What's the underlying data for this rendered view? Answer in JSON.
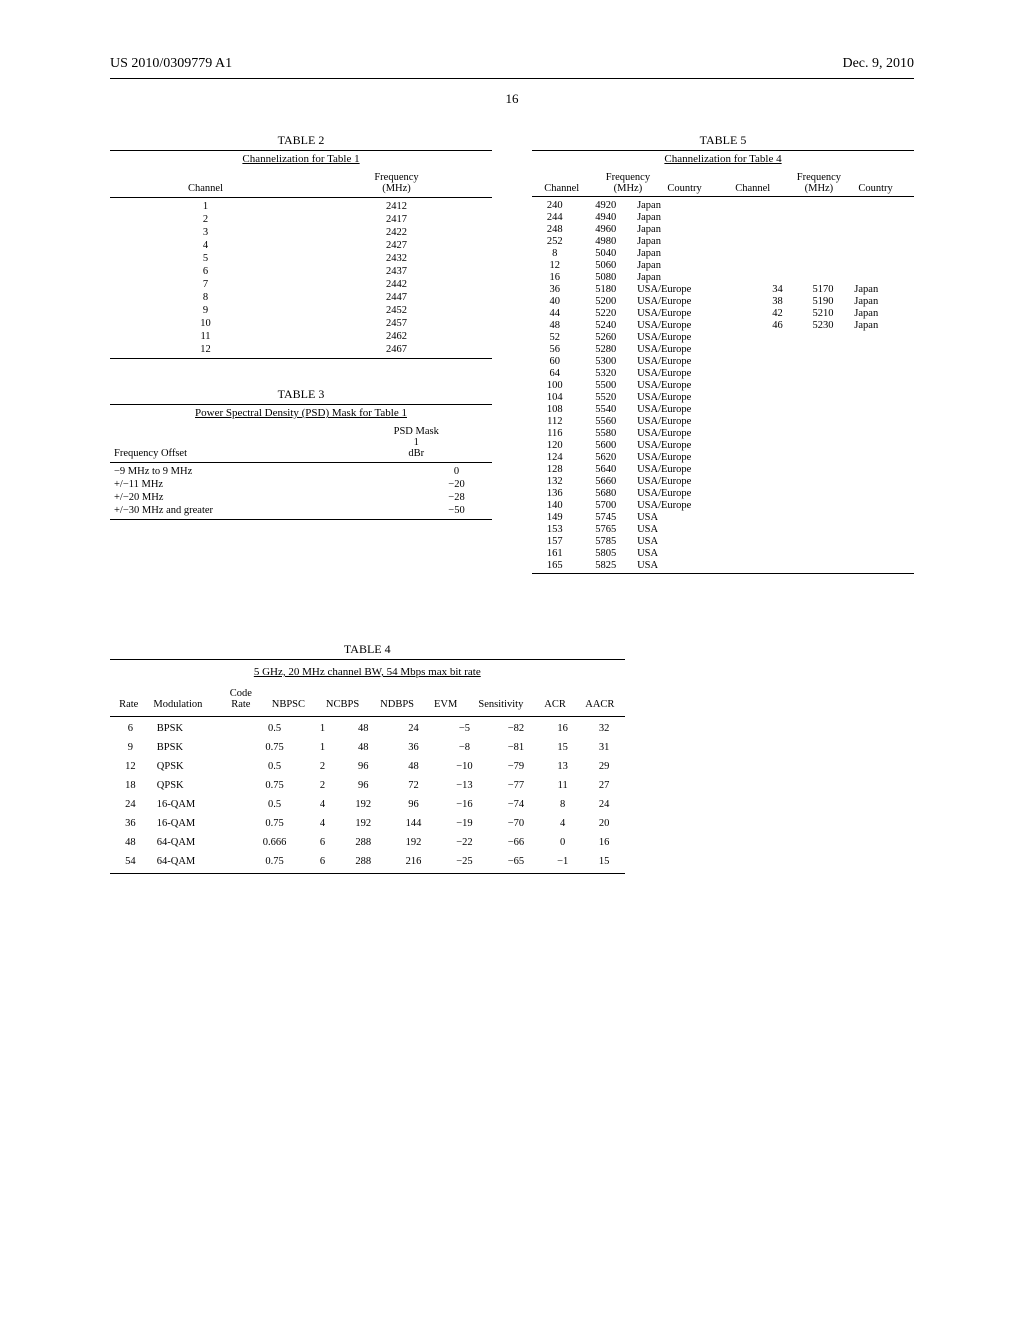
{
  "header": {
    "left": "US 2010/0309779 A1",
    "right": "Dec. 9, 2010"
  },
  "page_number": "16",
  "table2": {
    "title": "TABLE 2",
    "subtitle": "Channelization for Table 1",
    "head": {
      "c1": "Channel",
      "c2a": "Frequency",
      "c2b": "(MHz)"
    },
    "rows": [
      {
        "ch": "1",
        "f": "2412"
      },
      {
        "ch": "2",
        "f": "2417"
      },
      {
        "ch": "3",
        "f": "2422"
      },
      {
        "ch": "4",
        "f": "2427"
      },
      {
        "ch": "5",
        "f": "2432"
      },
      {
        "ch": "6",
        "f": "2437"
      },
      {
        "ch": "7",
        "f": "2442"
      },
      {
        "ch": "8",
        "f": "2447"
      },
      {
        "ch": "9",
        "f": "2452"
      },
      {
        "ch": "10",
        "f": "2457"
      },
      {
        "ch": "11",
        "f": "2462"
      },
      {
        "ch": "12",
        "f": "2467"
      }
    ]
  },
  "table3": {
    "title": "TABLE 3",
    "subtitle": "Power Spectral Density (PSD) Mask for Table 1",
    "head": {
      "c1": "Frequency Offset",
      "c2a": "PSD Mask",
      "c2b": "1",
      "c2c": "dBr"
    },
    "rows": [
      {
        "o": "−9 MHz to 9 MHz",
        "v": "0"
      },
      {
        "o": "+/−11 MHz",
        "v": "−20"
      },
      {
        "o": "+/−20 MHz",
        "v": "−28"
      },
      {
        "o": "+/−30 MHz and greater",
        "v": "−50"
      }
    ]
  },
  "table5": {
    "title": "TABLE 5",
    "subtitle": "Channelization for Table 4",
    "head": {
      "c1": "Channel",
      "c2a": "Frequency",
      "c2b": "(MHz)",
      "c3": "Country",
      "c4": "Channel",
      "c5a": "Frequency",
      "c5b": "(MHz)",
      "c6": "Country"
    },
    "rows": [
      {
        "ch": "240",
        "f": "4920",
        "ctry": "Japan",
        "ch2": "",
        "f2": "",
        "ctry2": ""
      },
      {
        "ch": "244",
        "f": "4940",
        "ctry": "Japan",
        "ch2": "",
        "f2": "",
        "ctry2": ""
      },
      {
        "ch": "248",
        "f": "4960",
        "ctry": "Japan",
        "ch2": "",
        "f2": "",
        "ctry2": ""
      },
      {
        "ch": "252",
        "f": "4980",
        "ctry": "Japan",
        "ch2": "",
        "f2": "",
        "ctry2": ""
      },
      {
        "ch": "8",
        "f": "5040",
        "ctry": "Japan",
        "ch2": "",
        "f2": "",
        "ctry2": ""
      },
      {
        "ch": "12",
        "f": "5060",
        "ctry": "Japan",
        "ch2": "",
        "f2": "",
        "ctry2": ""
      },
      {
        "ch": "16",
        "f": "5080",
        "ctry": "Japan",
        "ch2": "",
        "f2": "",
        "ctry2": ""
      },
      {
        "ch": "36",
        "f": "5180",
        "ctry": "USA/Europe",
        "ch2": "34",
        "f2": "5170",
        "ctry2": "Japan"
      },
      {
        "ch": "40",
        "f": "5200",
        "ctry": "USA/Europe",
        "ch2": "38",
        "f2": "5190",
        "ctry2": "Japan"
      },
      {
        "ch": "44",
        "f": "5220",
        "ctry": "USA/Europe",
        "ch2": "42",
        "f2": "5210",
        "ctry2": "Japan"
      },
      {
        "ch": "48",
        "f": "5240",
        "ctry": "USA/Europe",
        "ch2": "46",
        "f2": "5230",
        "ctry2": "Japan"
      },
      {
        "ch": "52",
        "f": "5260",
        "ctry": "USA/Europe",
        "ch2": "",
        "f2": "",
        "ctry2": ""
      },
      {
        "ch": "56",
        "f": "5280",
        "ctry": "USA/Europe",
        "ch2": "",
        "f2": "",
        "ctry2": ""
      },
      {
        "ch": "60",
        "f": "5300",
        "ctry": "USA/Europe",
        "ch2": "",
        "f2": "",
        "ctry2": ""
      },
      {
        "ch": "64",
        "f": "5320",
        "ctry": "USA/Europe",
        "ch2": "",
        "f2": "",
        "ctry2": ""
      },
      {
        "ch": "100",
        "f": "5500",
        "ctry": "USA/Europe",
        "ch2": "",
        "f2": "",
        "ctry2": ""
      },
      {
        "ch": "104",
        "f": "5520",
        "ctry": "USA/Europe",
        "ch2": "",
        "f2": "",
        "ctry2": ""
      },
      {
        "ch": "108",
        "f": "5540",
        "ctry": "USA/Europe",
        "ch2": "",
        "f2": "",
        "ctry2": ""
      },
      {
        "ch": "112",
        "f": "5560",
        "ctry": "USA/Europe",
        "ch2": "",
        "f2": "",
        "ctry2": ""
      },
      {
        "ch": "116",
        "f": "5580",
        "ctry": "USA/Europe",
        "ch2": "",
        "f2": "",
        "ctry2": ""
      },
      {
        "ch": "120",
        "f": "5600",
        "ctry": "USA/Europe",
        "ch2": "",
        "f2": "",
        "ctry2": ""
      },
      {
        "ch": "124",
        "f": "5620",
        "ctry": "USA/Europe",
        "ch2": "",
        "f2": "",
        "ctry2": ""
      },
      {
        "ch": "128",
        "f": "5640",
        "ctry": "USA/Europe",
        "ch2": "",
        "f2": "",
        "ctry2": ""
      },
      {
        "ch": "132",
        "f": "5660",
        "ctry": "USA/Europe",
        "ch2": "",
        "f2": "",
        "ctry2": ""
      },
      {
        "ch": "136",
        "f": "5680",
        "ctry": "USA/Europe",
        "ch2": "",
        "f2": "",
        "ctry2": ""
      },
      {
        "ch": "140",
        "f": "5700",
        "ctry": "USA/Europe",
        "ch2": "",
        "f2": "",
        "ctry2": ""
      },
      {
        "ch": "149",
        "f": "5745",
        "ctry": "USA",
        "ch2": "",
        "f2": "",
        "ctry2": ""
      },
      {
        "ch": "153",
        "f": "5765",
        "ctry": "USA",
        "ch2": "",
        "f2": "",
        "ctry2": ""
      },
      {
        "ch": "157",
        "f": "5785",
        "ctry": "USA",
        "ch2": "",
        "f2": "",
        "ctry2": ""
      },
      {
        "ch": "161",
        "f": "5805",
        "ctry": "USA",
        "ch2": "",
        "f2": "",
        "ctry2": ""
      },
      {
        "ch": "165",
        "f": "5825",
        "ctry": "USA",
        "ch2": "",
        "f2": "",
        "ctry2": ""
      }
    ]
  },
  "table4": {
    "title": "TABLE 4",
    "subtitle": "5 GHz, 20 MHz channel BW, 54 Mbps max bit rate",
    "head": {
      "rate": "Rate",
      "mod": "Modulation",
      "code1": "Code",
      "code2": "Rate",
      "nbpsc": "NBPSC",
      "ncbps": "NCBPS",
      "ndbps": "NDBPS",
      "evm": "EVM",
      "sens": "Sensitivity",
      "acr": "ACR",
      "aacr": "AACR"
    },
    "rows": [
      {
        "r": "6",
        "m": "BPSK",
        "c": "0.5",
        "nb": "1",
        "nc": "48",
        "nd": "24",
        "e": "−5",
        "s": "−82",
        "a": "16",
        "aa": "32"
      },
      {
        "r": "9",
        "m": "BPSK",
        "c": "0.75",
        "nb": "1",
        "nc": "48",
        "nd": "36",
        "e": "−8",
        "s": "−81",
        "a": "15",
        "aa": "31"
      },
      {
        "r": "12",
        "m": "QPSK",
        "c": "0.5",
        "nb": "2",
        "nc": "96",
        "nd": "48",
        "e": "−10",
        "s": "−79",
        "a": "13",
        "aa": "29"
      },
      {
        "r": "18",
        "m": "QPSK",
        "c": "0.75",
        "nb": "2",
        "nc": "96",
        "nd": "72",
        "e": "−13",
        "s": "−77",
        "a": "11",
        "aa": "27"
      },
      {
        "r": "24",
        "m": "16-QAM",
        "c": "0.5",
        "nb": "4",
        "nc": "192",
        "nd": "96",
        "e": "−16",
        "s": "−74",
        "a": "8",
        "aa": "24"
      },
      {
        "r": "36",
        "m": "16-QAM",
        "c": "0.75",
        "nb": "4",
        "nc": "192",
        "nd": "144",
        "e": "−19",
        "s": "−70",
        "a": "4",
        "aa": "20"
      },
      {
        "r": "48",
        "m": "64-QAM",
        "c": "0.666",
        "nb": "6",
        "nc": "288",
        "nd": "192",
        "e": "−22",
        "s": "−66",
        "a": "0",
        "aa": "16"
      },
      {
        "r": "54",
        "m": "64-QAM",
        "c": "0.75",
        "nb": "6",
        "nc": "288",
        "nd": "216",
        "e": "−25",
        "s": "−65",
        "a": "−1",
        "aa": "15"
      }
    ]
  },
  "chart_data": [
    {
      "type": "table",
      "title": "TABLE 2 — Channelization for Table 1",
      "columns": [
        "Channel",
        "Frequency (MHz)"
      ],
      "rows": [
        [
          1,
          2412
        ],
        [
          2,
          2417
        ],
        [
          3,
          2422
        ],
        [
          4,
          2427
        ],
        [
          5,
          2432
        ],
        [
          6,
          2437
        ],
        [
          7,
          2442
        ],
        [
          8,
          2447
        ],
        [
          9,
          2452
        ],
        [
          10,
          2457
        ],
        [
          11,
          2462
        ],
        [
          12,
          2467
        ]
      ]
    },
    {
      "type": "table",
      "title": "TABLE 3 — Power Spectral Density (PSD) Mask for Table 1",
      "columns": [
        "Frequency Offset",
        "PSD Mask 1 (dBr)"
      ],
      "rows": [
        [
          "−9 MHz to 9 MHz",
          0
        ],
        [
          "+/−11 MHz",
          -20
        ],
        [
          "+/−20 MHz",
          -28
        ],
        [
          "+/−30 MHz and greater",
          -50
        ]
      ]
    },
    {
      "type": "table",
      "title": "TABLE 4 — 5 GHz, 20 MHz channel BW, 54 Mbps max bit rate",
      "columns": [
        "Rate",
        "Modulation",
        "Code Rate",
        "NBPSC",
        "NCBPS",
        "NDBPS",
        "EVM",
        "Sensitivity",
        "ACR",
        "AACR"
      ],
      "rows": [
        [
          6,
          "BPSK",
          0.5,
          1,
          48,
          24,
          -5,
          -82,
          16,
          32
        ],
        [
          9,
          "BPSK",
          0.75,
          1,
          48,
          36,
          -8,
          -81,
          15,
          31
        ],
        [
          12,
          "QPSK",
          0.5,
          2,
          96,
          48,
          -10,
          -79,
          13,
          29
        ],
        [
          18,
          "QPSK",
          0.75,
          2,
          96,
          72,
          -13,
          -77,
          11,
          27
        ],
        [
          24,
          "16-QAM",
          0.5,
          4,
          192,
          96,
          -16,
          -74,
          8,
          24
        ],
        [
          36,
          "16-QAM",
          0.75,
          4,
          192,
          144,
          -19,
          -70,
          4,
          20
        ],
        [
          48,
          "64-QAM",
          0.666,
          6,
          288,
          192,
          -22,
          -66,
          0,
          16
        ],
        [
          54,
          "64-QAM",
          0.75,
          6,
          288,
          216,
          -25,
          -65,
          -1,
          15
        ]
      ]
    },
    {
      "type": "table",
      "title": "TABLE 5 — Channelization for Table 4",
      "columns": [
        "Channel",
        "Frequency (MHz)",
        "Country",
        "Channel",
        "Frequency (MHz)",
        "Country"
      ],
      "rows": [
        [
          240,
          4920,
          "Japan",
          null,
          null,
          null
        ],
        [
          244,
          4940,
          "Japan",
          null,
          null,
          null
        ],
        [
          248,
          4960,
          "Japan",
          null,
          null,
          null
        ],
        [
          252,
          4980,
          "Japan",
          null,
          null,
          null
        ],
        [
          8,
          5040,
          "Japan",
          null,
          null,
          null
        ],
        [
          12,
          5060,
          "Japan",
          null,
          null,
          null
        ],
        [
          16,
          5080,
          "Japan",
          null,
          null,
          null
        ],
        [
          36,
          5180,
          "USA/Europe",
          34,
          5170,
          "Japan"
        ],
        [
          40,
          5200,
          "USA/Europe",
          38,
          5190,
          "Japan"
        ],
        [
          44,
          5220,
          "USA/Europe",
          42,
          5210,
          "Japan"
        ],
        [
          48,
          5240,
          "USA/Europe",
          46,
          5230,
          "Japan"
        ],
        [
          52,
          5260,
          "USA/Europe",
          null,
          null,
          null
        ],
        [
          56,
          5280,
          "USA/Europe",
          null,
          null,
          null
        ],
        [
          60,
          5300,
          "USA/Europe",
          null,
          null,
          null
        ],
        [
          64,
          5320,
          "USA/Europe",
          null,
          null,
          null
        ],
        [
          100,
          5500,
          "USA/Europe",
          null,
          null,
          null
        ],
        [
          104,
          5520,
          "USA/Europe",
          null,
          null,
          null
        ],
        [
          108,
          5540,
          "USA/Europe",
          null,
          null,
          null
        ],
        [
          112,
          5560,
          "USA/Europe",
          null,
          null,
          null
        ],
        [
          116,
          5580,
          "USA/Europe",
          null,
          null,
          null
        ],
        [
          120,
          5600,
          "USA/Europe",
          null,
          null,
          null
        ],
        [
          124,
          5620,
          "USA/Europe",
          null,
          null,
          null
        ],
        [
          128,
          5640,
          "USA/Europe",
          null,
          null,
          null
        ],
        [
          132,
          5660,
          "USA/Europe",
          null,
          null,
          null
        ],
        [
          136,
          5680,
          "USA/Europe",
          null,
          null,
          null
        ],
        [
          140,
          5700,
          "USA/Europe",
          null,
          null,
          null
        ],
        [
          149,
          5745,
          "USA",
          null,
          null,
          null
        ],
        [
          153,
          5765,
          "USA",
          null,
          null,
          null
        ],
        [
          157,
          5785,
          "USA",
          null,
          null,
          null
        ],
        [
          161,
          5805,
          "USA",
          null,
          null,
          null
        ],
        [
          165,
          5825,
          "USA",
          null,
          null,
          null
        ]
      ]
    }
  ]
}
